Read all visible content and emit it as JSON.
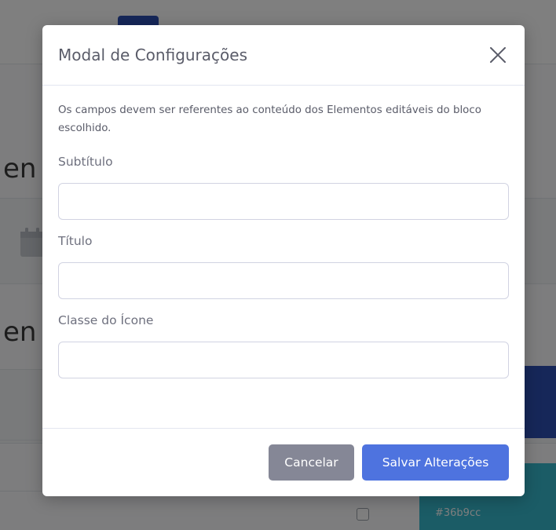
{
  "background": {
    "heading_fragment_1": "en",
    "heading_fragment_2": "en",
    "teal_card_label": "#36b9cc",
    "colors": {
      "blue_card": "#2c4fb3",
      "teal_card": "#36b9cc"
    }
  },
  "modal": {
    "title": "Modal de Configurações",
    "close_icon": "close-icon",
    "description": "Os campos devem ser referentes ao conteúdo dos Elementos editáveis do bloco escolhido.",
    "fields": [
      {
        "label": "Subtítulo",
        "value": "",
        "placeholder": ""
      },
      {
        "label": "Título",
        "value": "",
        "placeholder": ""
      },
      {
        "label": "Classe do Ícone",
        "value": "",
        "placeholder": ""
      }
    ],
    "buttons": {
      "cancel": "Cancelar",
      "save": "Salvar Alterações"
    },
    "colors": {
      "primary": "#4e73df",
      "secondary": "#858796"
    }
  }
}
